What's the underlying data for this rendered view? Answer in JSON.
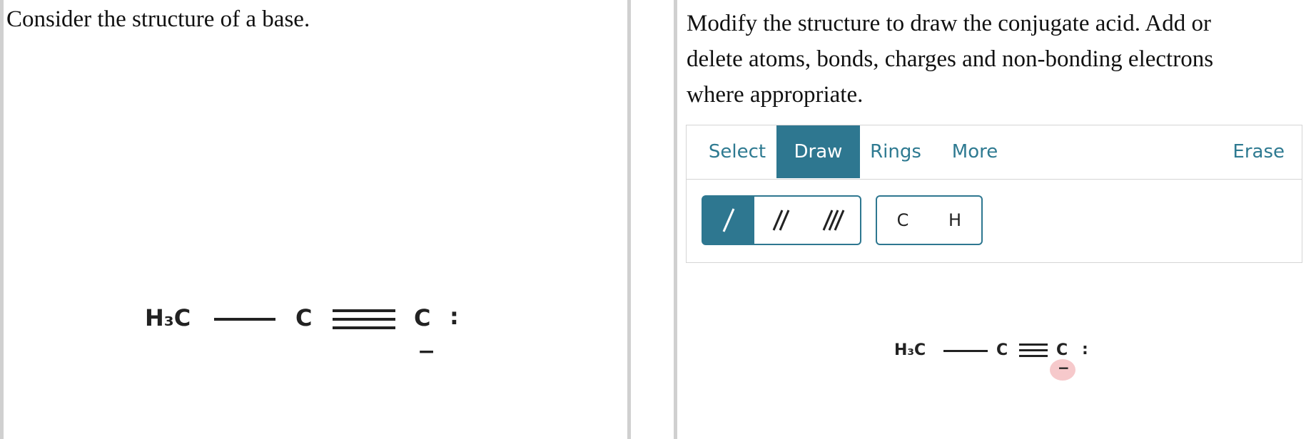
{
  "left": {
    "prompt": "Consider the structure of a base.",
    "molecule": {
      "group": "H₃C",
      "atom1": "C",
      "atom2": "C",
      "lone_pair": ":",
      "charge": "−"
    }
  },
  "right": {
    "prompt": "Modify the structure to draw the conjugate acid. Add or delete atoms, bonds, charges and non-bonding electrons where appropriate.",
    "toolbar": {
      "tabs": [
        "Select",
        "Draw",
        "Rings",
        "More"
      ],
      "erase": "Erase",
      "atoms": [
        "C",
        "H"
      ]
    },
    "molecule": {
      "group": "H₃C",
      "atom1": "C",
      "atom2": "C",
      "lone_pair": ":",
      "charge": "−"
    }
  }
}
